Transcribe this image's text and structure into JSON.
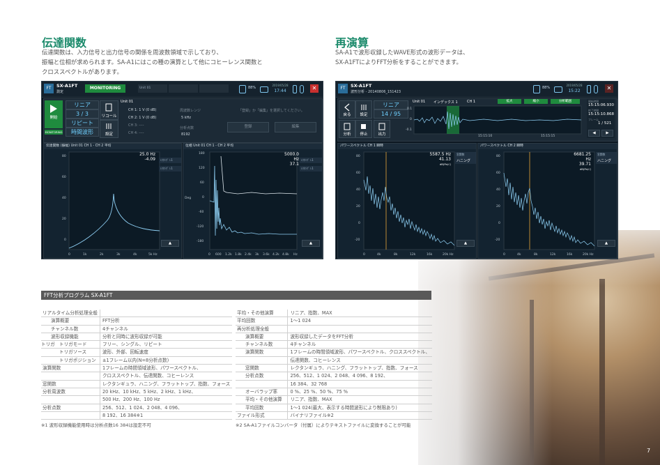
{
  "left_section": {
    "heading": "伝達関数",
    "lines": [
      "伝達関数は、入力信号と出力信号の関係を周波数領域で示しており、",
      "振幅と位相が求められます。SA-A1にはこの種の演算として他にコヒーレンス関数と",
      "クロススペクトルがあります。"
    ]
  },
  "right_section": {
    "heading": "再演算",
    "lines": [
      "SA-A1で波形収録したWAVE形式の波形データは、",
      "SX-A1FTによりFFT分析をすることができます。"
    ]
  },
  "screen1": {
    "logo": "FT",
    "title": "SX-A1FT",
    "subtitle": "測定",
    "monitoring": "MONITORING",
    "unit_cell": "Unit 01",
    "battery": "88%",
    "clock_label": "2019/05/28",
    "clock": "17:44",
    "close": "✕",
    "start_label": "開始",
    "monitoring_small": "MONITORING",
    "mode": "リニア",
    "count": "3 / 3",
    "repeat": "リピート",
    "time_wave": "時間波形",
    "recall": "リコール",
    "settings": "設定",
    "unit_tab": "Unit 01",
    "channels": [
      "CH 1: 1 V (0 dB)",
      "CH 2: 1 V (0 dB)",
      "CH 3: ----",
      "CH 4: ----"
    ],
    "freq_range_label": "周波数レンジ",
    "freq_range": "5 kHz",
    "points_label": "分析点数",
    "points": "8192",
    "hint": "「登録」か「編集」を選択してください。",
    "reg_btn": "登録",
    "edit_btn": "編集",
    "graph1": {
      "head": "伝達関数 (振幅)   Unit 01   CH 1 - CH 2   平均",
      "readout_f": "25.0 Hz",
      "readout_v": "-4.09",
      "side": [
        "ﾚｸﾀﾝｸﾞ ﾚ1",
        "ﾚｸﾀﾝｸﾞ ﾚ1"
      ],
      "yticks": [
        "80",
        "60",
        "40",
        "20",
        "0"
      ],
      "xticks": [
        "0",
        "1k",
        "2k",
        "3k",
        "4k",
        "5k Hz"
      ]
    },
    "graph2": {
      "head": "位相   Unit 01   CH 1 - CH 2   平均",
      "readout_f": "5000.0 Hz",
      "readout_v": "37.1",
      "unit": "Deg",
      "side": [
        "ﾚｸﾀﾝｸﾞ ﾚ1",
        "ﾚｸﾀﾝｸﾞ ﾚ1"
      ],
      "yticks": [
        "180",
        "120",
        "60",
        "0",
        "-60",
        "-120",
        "-180"
      ],
      "xticks": [
        "0",
        "600",
        "1.2k",
        "1.8k",
        "2.4k",
        "3k",
        "3.6k",
        "4.2k",
        "4.8k",
        "Hz"
      ]
    }
  },
  "screen2": {
    "logo": "FT",
    "title": "SX-A1FT",
    "subtitle": "波形分析 - 20140806_151423",
    "battery": "88%",
    "clock_label": "2019/05/28",
    "clock": "15:22",
    "close": "✕",
    "back": "戻る",
    "settings": "設定",
    "mode": "リニア",
    "count": "14 / 95",
    "analyze": "分析",
    "stop": "停止",
    "output": "出力",
    "index_row": [
      "Unit 01",
      "インデックス 1",
      "CH 1"
    ],
    "green_btns": [
      "拡大",
      "縮小",
      "分析範囲"
    ],
    "wave_yticks": [
      "0.1",
      "0",
      "-0.1"
    ],
    "wave_xticks": [
      "15:15:10",
      "15:15:15"
    ],
    "times": [
      {
        "label": "開始時間",
        "value": "15:15:06.930"
      },
      {
        "label": "終了時間",
        "value": "15:15:10.868"
      },
      {
        "label": "フレーム",
        "value": "1 / 521"
      }
    ],
    "spec1": {
      "head": "パワースペクトル   CH 1   瞬時",
      "readout_f": "5587.5 Hz",
      "readout_v": "41.13",
      "unit": "dB(Pa/√)",
      "window_label": "窓関数",
      "window": "ハニング",
      "yticks": [
        "80",
        "60",
        "40",
        "20",
        "0",
        "-20"
      ],
      "xticks": [
        "0",
        "4k",
        "8k",
        "12k",
        "16k",
        "20k Hz"
      ]
    },
    "spec2": {
      "head": "パワースペクトル   CH 2   瞬時",
      "readout_f": "6681.25 Hz",
      "readout_v": "39.71",
      "unit": "dB(Pa/√)",
      "window_label": "窓関数",
      "window": "ハニング",
      "yticks": [
        "80",
        "60",
        "40",
        "20",
        "0",
        "-20"
      ],
      "xticks": [
        "0",
        "4k",
        "8k",
        "12k",
        "16k",
        "20k Hz"
      ]
    }
  },
  "table_title": "FFT分析プログラム SX-A1FT",
  "table_left": [
    {
      "k": "リアルタイム分析処理全般",
      "v": "",
      "lvl": 0
    },
    {
      "k": "演算概要",
      "v": "FFT分析",
      "lvl": 1
    },
    {
      "k": "チャンネル数",
      "v": "4チャンネル",
      "lvl": 1
    },
    {
      "k": "波形収録機能",
      "v": "分析と同時に波形収録が可能",
      "lvl": 1
    },
    {
      "k": "トリガ",
      "k2": "トリガモード",
      "v": "フリー、シングル、リピート",
      "lvl": 2
    },
    {
      "k": "",
      "k2": "トリガソース",
      "v": "波形、外部、回転速度",
      "lvl": 2
    },
    {
      "k": "",
      "k2": "トリガポジション",
      "v": "±1フレーム以内(N=8分析点数)",
      "lvl": 2
    },
    {
      "k": "演算関数",
      "v": "1フレームの時間領域波形、パワースペクトル、",
      "lvl": 0
    },
    {
      "k": "",
      "v": "クロススペクトル、伝達関数、コヒーレンス",
      "lvl": 0
    },
    {
      "k": "窓関数",
      "v": "レクタンギュラ、ハニング、フラットトップ、指数、フォース",
      "lvl": 0
    },
    {
      "k": "分析周波数",
      "v": "20 kHz、10 kHz、5 kHz、2 kHz、1 kHz、",
      "lvl": 0
    },
    {
      "k": "",
      "v": "500 Hz、200 Hz、100 Hz",
      "lvl": 0
    },
    {
      "k": "分析点数",
      "v": "256、512、1 024、2 048、4 096、",
      "lvl": 0
    },
    {
      "k": "",
      "v": "8 192、16 384※1",
      "lvl": 0
    }
  ],
  "note_left": "※1  波形収録機能使用時は分析点数16 384は設定不可",
  "table_right": [
    {
      "k": "平均・その他演算",
      "v": "リニア、指数、MAX",
      "lvl": 0
    },
    {
      "k": "平均回数",
      "v": "1～1 024",
      "lvl": 0
    },
    {
      "k": "再分析処理全般",
      "v": "",
      "lvl": 0
    },
    {
      "k": "演算概要",
      "v": "波形収録したデータをFFT分析",
      "lvl": 1
    },
    {
      "k": "チャンネル数",
      "v": "4チャンネル",
      "lvl": 1
    },
    {
      "k": "演算関数",
      "v": "1フレームの時間領域波形、パワースペクトル、クロススペクトル、",
      "lvl": 1
    },
    {
      "k": "",
      "v": "伝達関数、コヒーレンス",
      "lvl": 1
    },
    {
      "k": "窓関数",
      "v": "レクタンギュラ、ハニング、フラットトップ、指数、フォース",
      "lvl": 1
    },
    {
      "k": "分析点数",
      "v": "256、512、1 024、2 048、4 096、8 192、",
      "lvl": 1
    },
    {
      "k": "",
      "v": "16 384、32 768",
      "lvl": 1
    },
    {
      "k": "オーバラップ率",
      "v": "0 %、25 %、50 %、75 %",
      "lvl": 1
    },
    {
      "k": "平均・その他演算",
      "v": "リニア、指数、MAX",
      "lvl": 1
    },
    {
      "k": "平均回数",
      "v": "1～1 024(最大、表示する時間波形により制限あり)",
      "lvl": 1
    },
    {
      "k": "ファイル形式",
      "v": "バイナリファイル※2",
      "lvl": 0
    }
  ],
  "note_right": "※2  SA-A1ファイルコンバータ（付属）によりテキストファイルに変換することが可能",
  "page_number": "7",
  "colors": {
    "accent": "#1b8a6b",
    "screen_bg": "#0b1620",
    "trace": "#8fd0f5",
    "marker": "#e8a53a"
  }
}
